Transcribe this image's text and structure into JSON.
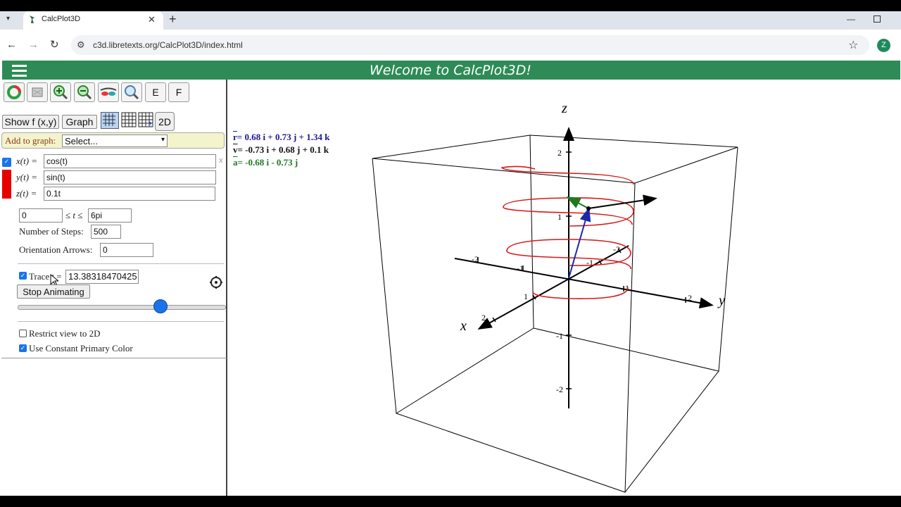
{
  "browser": {
    "tab_title": "CalcPlot3D",
    "url": "c3d.libretexts.org/CalcPlot3D/index.html",
    "profile_initial": "Z"
  },
  "app": {
    "welcome": "Welcome to CalcPlot3D!",
    "toolbar": {
      "e_label": "E",
      "f_label": "F",
      "show_fxy_label": "Show f (x,y)",
      "graph_label": "Graph",
      "twod_label": "2D"
    },
    "add_to_graph_label": "Add to graph:",
    "add_to_graph_selected": "Select...",
    "curve": {
      "x_label": "x(t) =",
      "x_value": "cos(t)",
      "y_label": "y(t) =",
      "y_value": "sin(t)",
      "z_label": "z(t) =",
      "z_value": "0.1t",
      "close_glyph": "x",
      "color": "#e60000"
    },
    "t_min": "0",
    "t_range_label": "≤ t ≤",
    "t_max": "6pi",
    "steps_label": "Number of Steps:",
    "steps_value": "500",
    "arrows_label": "Orientation Arrows:",
    "arrows_value": "0",
    "trace_label": "Trace t =",
    "trace_value": "13.38318470425",
    "trace_checked": true,
    "stop_animating_label": "Stop Animating",
    "slider_fraction": 0.69,
    "restrict_2d_label": "Restrict view to 2D",
    "restrict_2d_checked": false,
    "constant_color_label": "Use Constant Primary Color",
    "constant_color_checked": true
  },
  "vectors": {
    "r": "= 0.68 i + 0.73 j + 1.34 k",
    "v": "= -0.73 i + 0.68 j + 0.1 k",
    "a": "= -0.68 i - 0.73 j",
    "r_name": "r",
    "v_name": "v",
    "a_name": "a",
    "r_color": "#1a1a8c",
    "v_color": "#111111",
    "a_color": "#1e7a1e"
  },
  "axes": {
    "x_label": "x",
    "y_label": "y",
    "z_label": "z",
    "ticks": {
      "z_pos2": "2",
      "z_pos1": "1",
      "z_neg1": "-1",
      "z_neg2": "-2",
      "x_pos1": "1",
      "x_pos2": "2",
      "x_neg1": "-1",
      "x_neg2": "-2",
      "y_pos1": "1",
      "y_pos2": "2",
      "y_neg1": "-1",
      "y_neg2": "-2"
    }
  }
}
